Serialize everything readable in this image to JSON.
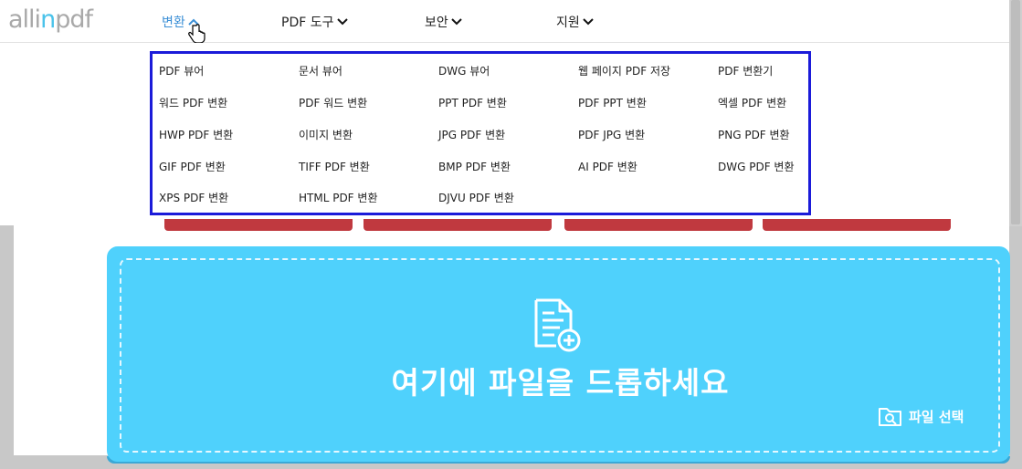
{
  "logo": {
    "pre": "alli",
    "accent": "n",
    "post": "pdf"
  },
  "nav": [
    {
      "label": "변환"
    },
    {
      "label": "PDF 도구"
    },
    {
      "label": "보안"
    },
    {
      "label": "지원"
    }
  ],
  "dropdown": {
    "items": [
      "PDF 뷰어",
      "문서 뷰어",
      "DWG 뷰어",
      "웹 페이지 PDF 저장",
      "PDF 변환기",
      "워드 PDF 변환",
      "PDF 워드 변환",
      "PPT PDF 변환",
      "PDF PPT 변환",
      "엑셀 PDF 변환",
      "HWP PDF 변환",
      "이미지 변환",
      "JPG PDF 변환",
      "PDF JPG 변환",
      "PNG PDF 변환",
      "GIF PDF 변환",
      "TIFF PDF 변환",
      "BMP PDF 변환",
      "AI PDF 변환",
      "DWG PDF 변환",
      "XPS PDF 변환",
      "HTML PDF 변환",
      "DJVU PDF 변환"
    ]
  },
  "dropzone": {
    "text": "여기에 파일을 드롭하세요",
    "select_label": "파일 선택"
  },
  "colors": {
    "accent": "#4bc3ea",
    "dropzone": "#4fd1fc",
    "highlight_border": "#1b1bd9",
    "red_button": "#c0393f"
  },
  "icons": [
    "chevron-up-icon",
    "chevron-down-icon",
    "hand-cursor-icon",
    "file-add-icon",
    "folder-search-icon"
  ]
}
